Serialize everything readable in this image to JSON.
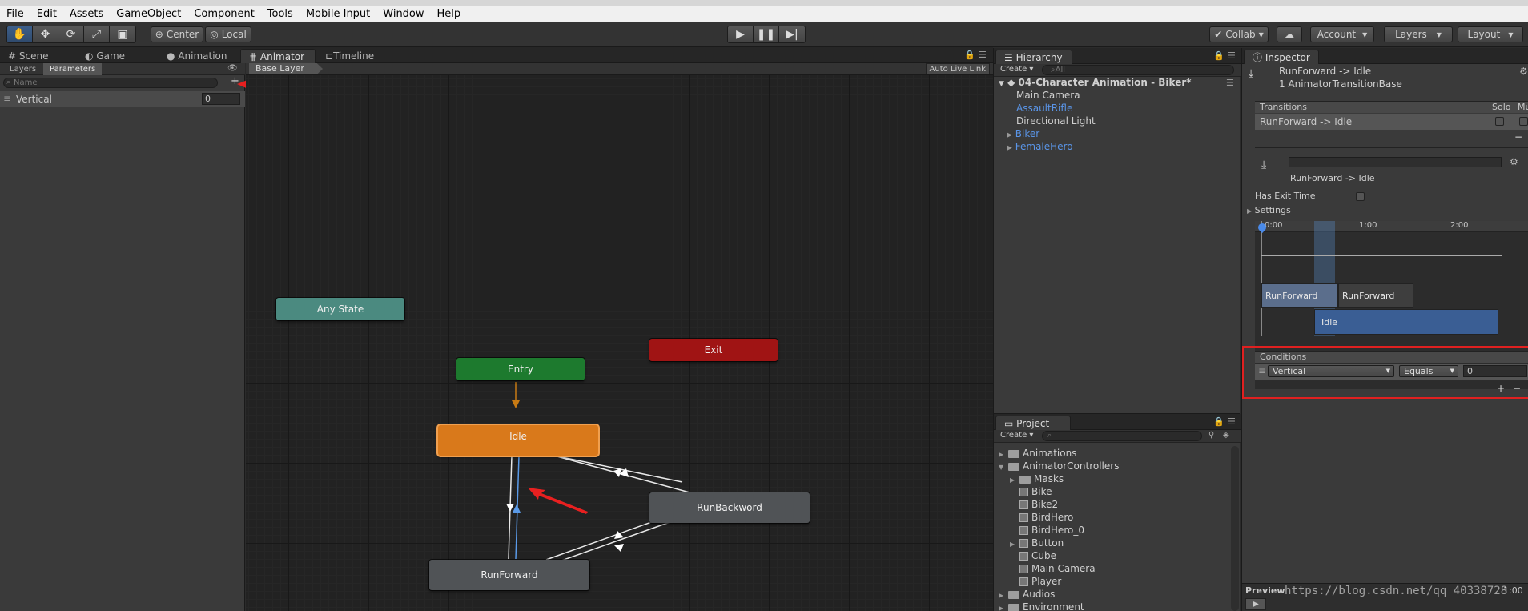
{
  "menu": [
    "File",
    "Edit",
    "Assets",
    "GameObject",
    "Component",
    "Tools",
    "Mobile Input",
    "Window",
    "Help"
  ],
  "toolbar": {
    "pivot": "Center",
    "space": "Local",
    "collab": "Collab",
    "account": "Account",
    "layers": "Layers",
    "layout": "Layout"
  },
  "tabs": {
    "scene": "Scene",
    "game": "Game",
    "animation": "Animation",
    "animator": "Animator",
    "timeline": "Timeline",
    "hierarchy": "Hierarchy",
    "inspector": "Inspector",
    "project": "Project"
  },
  "params": {
    "layers_tab": "Layers",
    "parameters_tab": "Parameters",
    "search_placeholder": "Name",
    "add": "+",
    "rows": [
      {
        "name": "Vertical",
        "value": "0"
      }
    ]
  },
  "animator": {
    "breadcrumb": "Base Layer",
    "auto_live_link": "Auto Live Link",
    "states": {
      "any_state": "Any State",
      "entry": "Entry",
      "exit": "Exit",
      "idle": "Idle",
      "run_backword": "RunBackword",
      "run_forward": "RunForward"
    },
    "colors": {
      "any_state": "#4a8a80",
      "entry": "#1d7a2e",
      "exit": "#a01414",
      "idle": "#d9791b",
      "normal": "#505356"
    }
  },
  "hierarchy": {
    "create": "Create",
    "search_placeholder": "All",
    "scene": "04-Character Animation - Biker*",
    "items": [
      {
        "label": "Main Camera",
        "prefab": false,
        "expandable": false
      },
      {
        "label": "AssaultRifle",
        "prefab": true,
        "expandable": false
      },
      {
        "label": "Directional Light",
        "prefab": false,
        "expandable": false
      },
      {
        "label": "Biker",
        "prefab": true,
        "expandable": true
      },
      {
        "label": "FemaleHero",
        "prefab": true,
        "expandable": true
      }
    ]
  },
  "project": {
    "create": "Create",
    "items": [
      {
        "label": "Animations",
        "type": "folder",
        "depth": 0,
        "expander": "▶"
      },
      {
        "label": "AnimatorControllers",
        "type": "folder",
        "depth": 0,
        "expander": "▼"
      },
      {
        "label": "Masks",
        "type": "folder",
        "depth": 1,
        "expander": "▶"
      },
      {
        "label": "Bike",
        "type": "asset",
        "depth": 1,
        "expander": ""
      },
      {
        "label": "Bike2",
        "type": "asset",
        "depth": 1,
        "expander": ""
      },
      {
        "label": "BirdHero",
        "type": "asset",
        "depth": 1,
        "expander": ""
      },
      {
        "label": "BirdHero_0",
        "type": "asset",
        "depth": 1,
        "expander": ""
      },
      {
        "label": "Button",
        "type": "asset",
        "depth": 1,
        "expander": "▶"
      },
      {
        "label": "Cube",
        "type": "asset",
        "depth": 1,
        "expander": ""
      },
      {
        "label": "Main Camera",
        "type": "asset",
        "depth": 1,
        "expander": ""
      },
      {
        "label": "Player",
        "type": "asset",
        "depth": 1,
        "expander": ""
      },
      {
        "label": "Audios",
        "type": "folder",
        "depth": 0,
        "expander": "▶"
      },
      {
        "label": "Environment",
        "type": "folder",
        "depth": 0,
        "expander": "▶"
      }
    ]
  },
  "inspector": {
    "title": "RunForward -> Idle",
    "subtitle": "1 AnimatorTransitionBase",
    "transitions_header": "Transitions",
    "solo": "Solo",
    "mute": "Mute",
    "transition_row": "RunForward -> Idle",
    "transition_name": "RunForward -> Idle",
    "has_exit_time": "Has Exit Time",
    "settings": "Settings",
    "timeline_ticks": [
      "0:00",
      "1:00",
      "2:00"
    ],
    "clip_a": "RunForward",
    "clip_b": "RunForward",
    "clip_idle": "Idle",
    "conditions_header": "Conditions",
    "condition": {
      "param": "Vertical",
      "mode": "Equals",
      "value": "0"
    },
    "add": "+",
    "remove": "−",
    "preview": "Preview",
    "preview_time": "1:00"
  },
  "watermark": "https://blog.csdn.net/qq_40338728"
}
